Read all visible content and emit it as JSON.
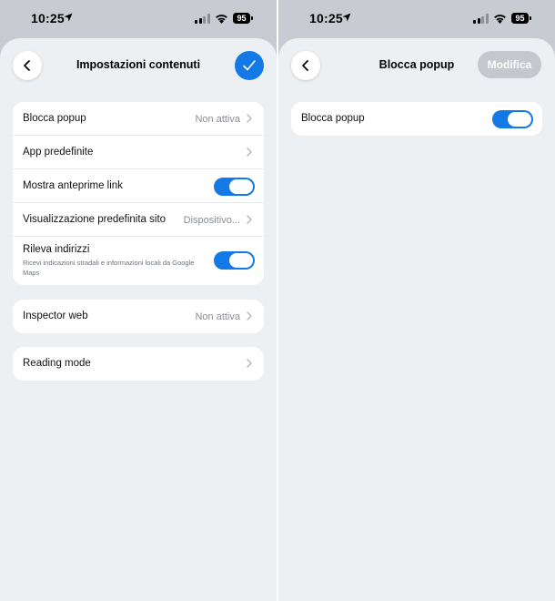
{
  "left": {
    "status": {
      "time": "10:25",
      "battery": "95"
    },
    "header": {
      "title": "Impostazioni contenuti"
    },
    "group1": [
      {
        "label": "Blocca popup",
        "value": "Non attiva",
        "type": "nav"
      },
      {
        "label": "App predefinite",
        "value": "",
        "type": "nav"
      },
      {
        "label": "Mostra anteprime link",
        "type": "toggle",
        "on": true
      },
      {
        "label": "Visualizzazione predefinita sito",
        "value": "Dispositivo...",
        "type": "nav"
      },
      {
        "label": "Rileva indirizzi",
        "sub": "Ricevi indicazioni stradali e informazioni locali da Google Maps",
        "type": "toggle",
        "on": true
      }
    ],
    "group2": [
      {
        "label": "Inspector web",
        "value": "Non attiva",
        "type": "nav"
      }
    ],
    "group3": [
      {
        "label": "Reading mode",
        "type": "nav"
      }
    ]
  },
  "right": {
    "status": {
      "time": "10:25",
      "battery": "95"
    },
    "header": {
      "title": "Blocca popup",
      "action_label": "Modifica"
    },
    "group1": [
      {
        "label": "Blocca popup",
        "type": "toggle",
        "on": true
      }
    ]
  },
  "colors": {
    "accent": "#1279e6",
    "sheet_bg": "#edf0f2",
    "backdrop": "#c8ccd2",
    "disabled_button": "#c4c7cc"
  }
}
